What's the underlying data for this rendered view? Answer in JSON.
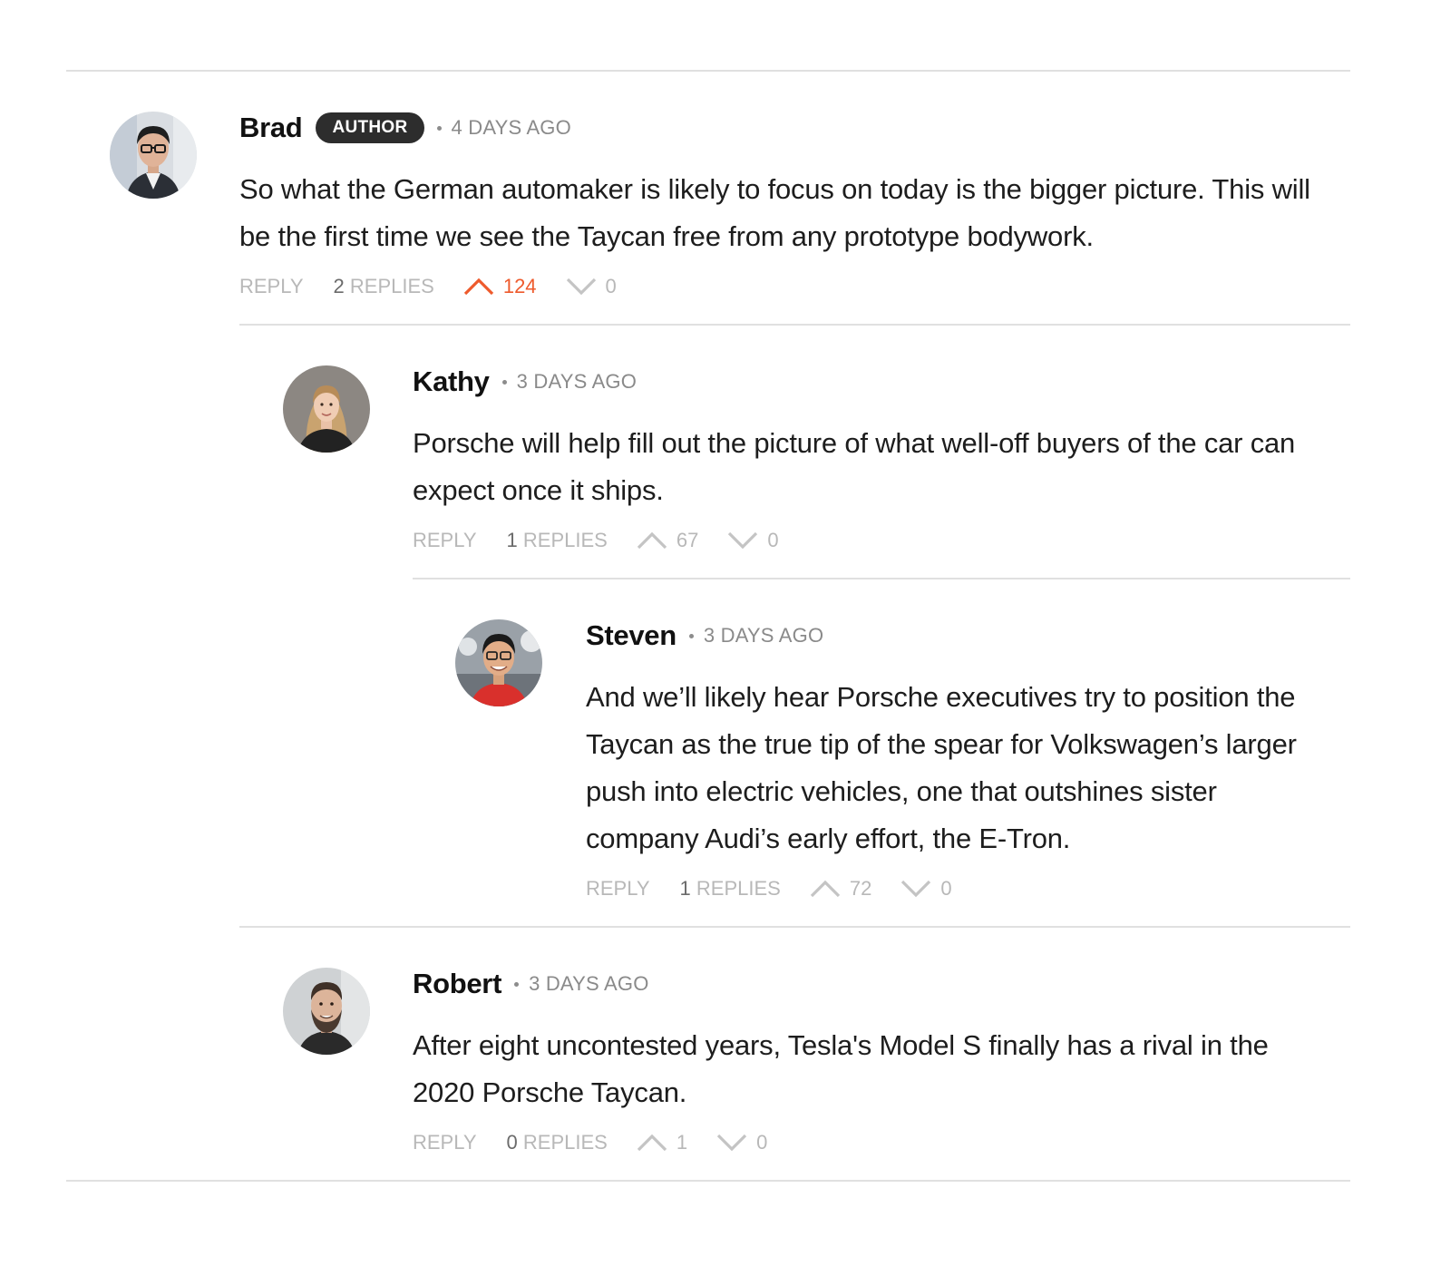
{
  "actions": {
    "reply_label": "REPLY",
    "replies_label": "REPLIES"
  },
  "colors": {
    "accent_upvote": "#ee5a2c",
    "muted": "#b8b8b8",
    "badge_bg": "#2d2d2d"
  },
  "comments": [
    {
      "author": "Brad",
      "badge": "AUTHOR",
      "time": "4 DAYS AGO",
      "text": "So what the German automaker is likely to focus on today is the bigger picture. This will be the first time we see the Taycan free from any prototype bodywork.",
      "replies": "2",
      "upvotes": "124",
      "downvotes": "0",
      "upvoted": true
    },
    {
      "author": "Kathy",
      "time": "3 DAYS AGO",
      "text": "Porsche will help fill out the picture of what well-off buyers of the car can expect once it ships.",
      "replies": "1",
      "upvotes": "67",
      "downvotes": "0",
      "upvoted": false
    },
    {
      "author": "Steven",
      "time": "3 DAYS AGO",
      "text": "And we’ll likely hear Porsche executives try to position the Taycan as the true tip of the spear for Volkswagen’s larger push into electric vehicles, one that outshines sister company Audi’s early effort, the E-Tron.",
      "replies": "1",
      "upvotes": "72",
      "downvotes": "0",
      "upvoted": false
    },
    {
      "author": "Robert",
      "time": "3 DAYS AGO",
      "text": "After eight uncontested years, Tesla's Model S finally has a rival in the 2020 Porsche Taycan.",
      "replies": "0",
      "upvotes": "1",
      "downvotes": "0",
      "upvoted": false
    }
  ]
}
